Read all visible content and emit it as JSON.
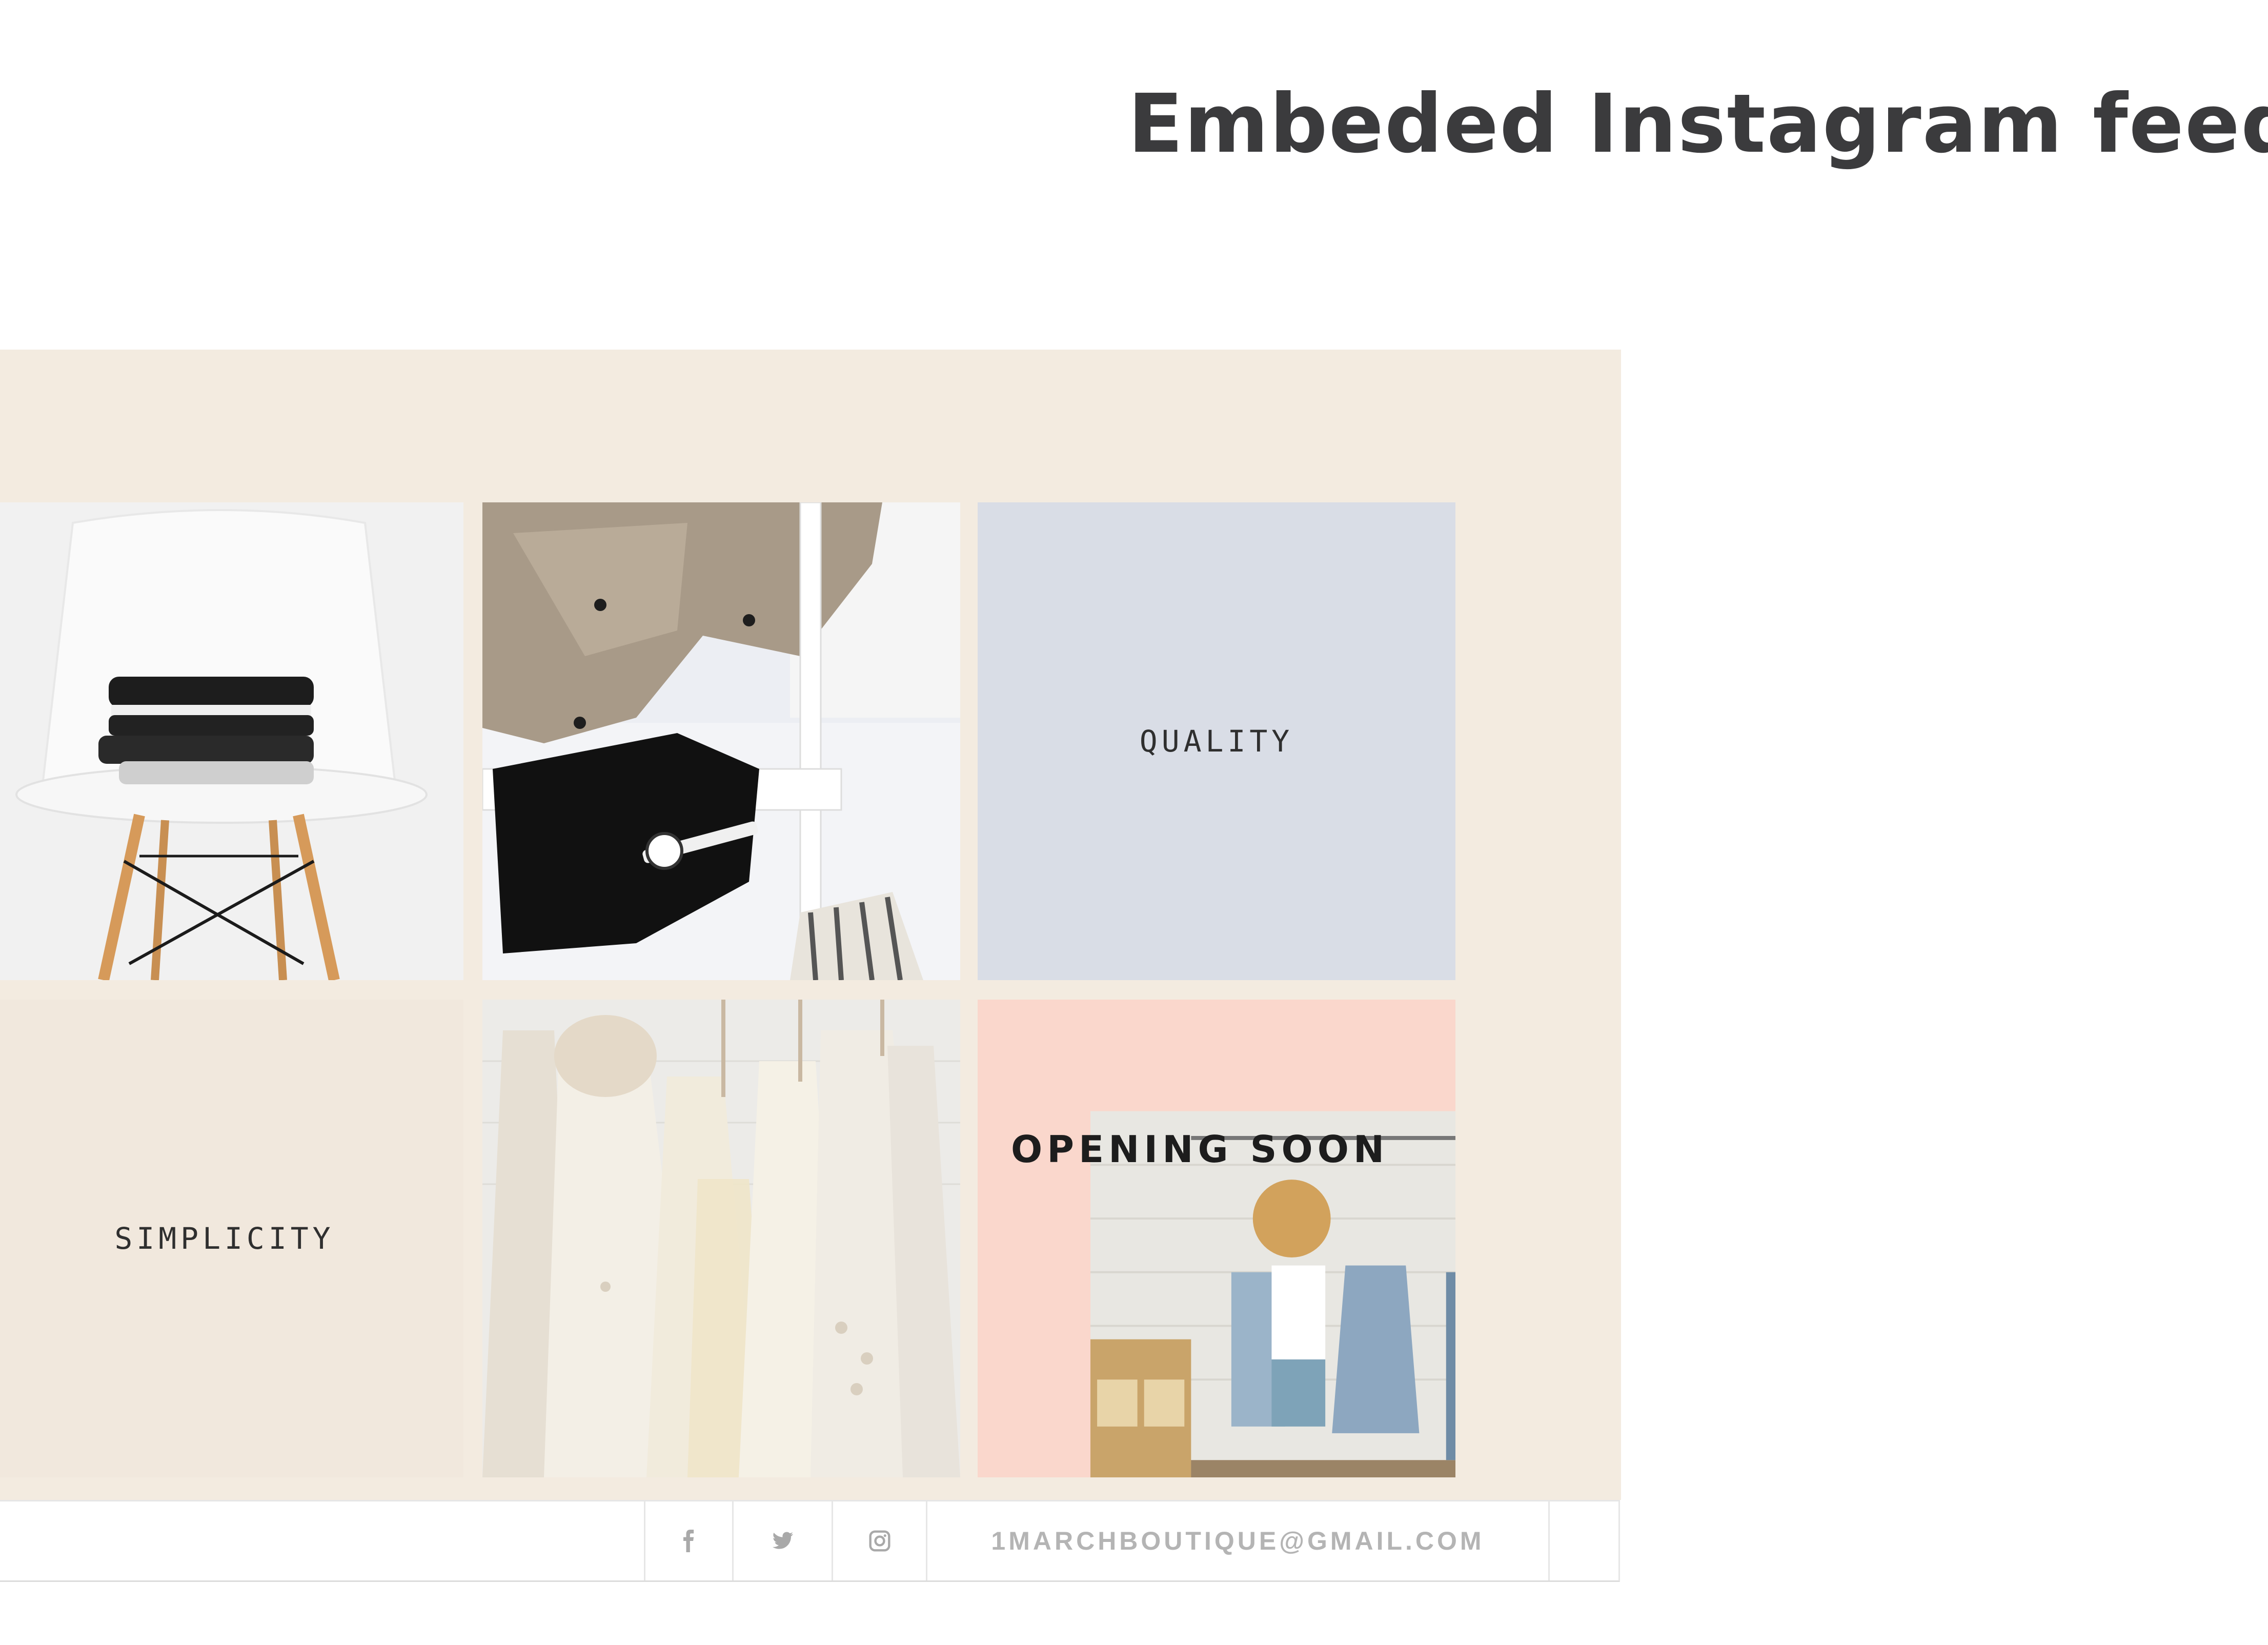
{
  "page": {
    "heading": "Embeded Instagram feed"
  },
  "feed": {
    "tiles": [
      {
        "kind": "photo",
        "subject": "folded-clothes-on-chair"
      },
      {
        "kind": "photo",
        "subject": "clothes-and-watch-on-rack"
      },
      {
        "kind": "text",
        "label": "QUALITY",
        "background": "#d9dde6"
      },
      {
        "kind": "text",
        "label": "SIMPLICITY",
        "background": "#f1e8dd"
      },
      {
        "kind": "photo",
        "subject": "white-dresses-on-hangers"
      },
      {
        "kind": "promo",
        "label": "OPENING SOON",
        "background": "#fad7cc"
      }
    ],
    "panel_background": "#f3ebe0"
  },
  "footer": {
    "icons": [
      "facebook-icon",
      "twitter-icon",
      "instagram-icon"
    ],
    "email": "1MARCHBOUTIQUE@GMAIL.COM"
  }
}
